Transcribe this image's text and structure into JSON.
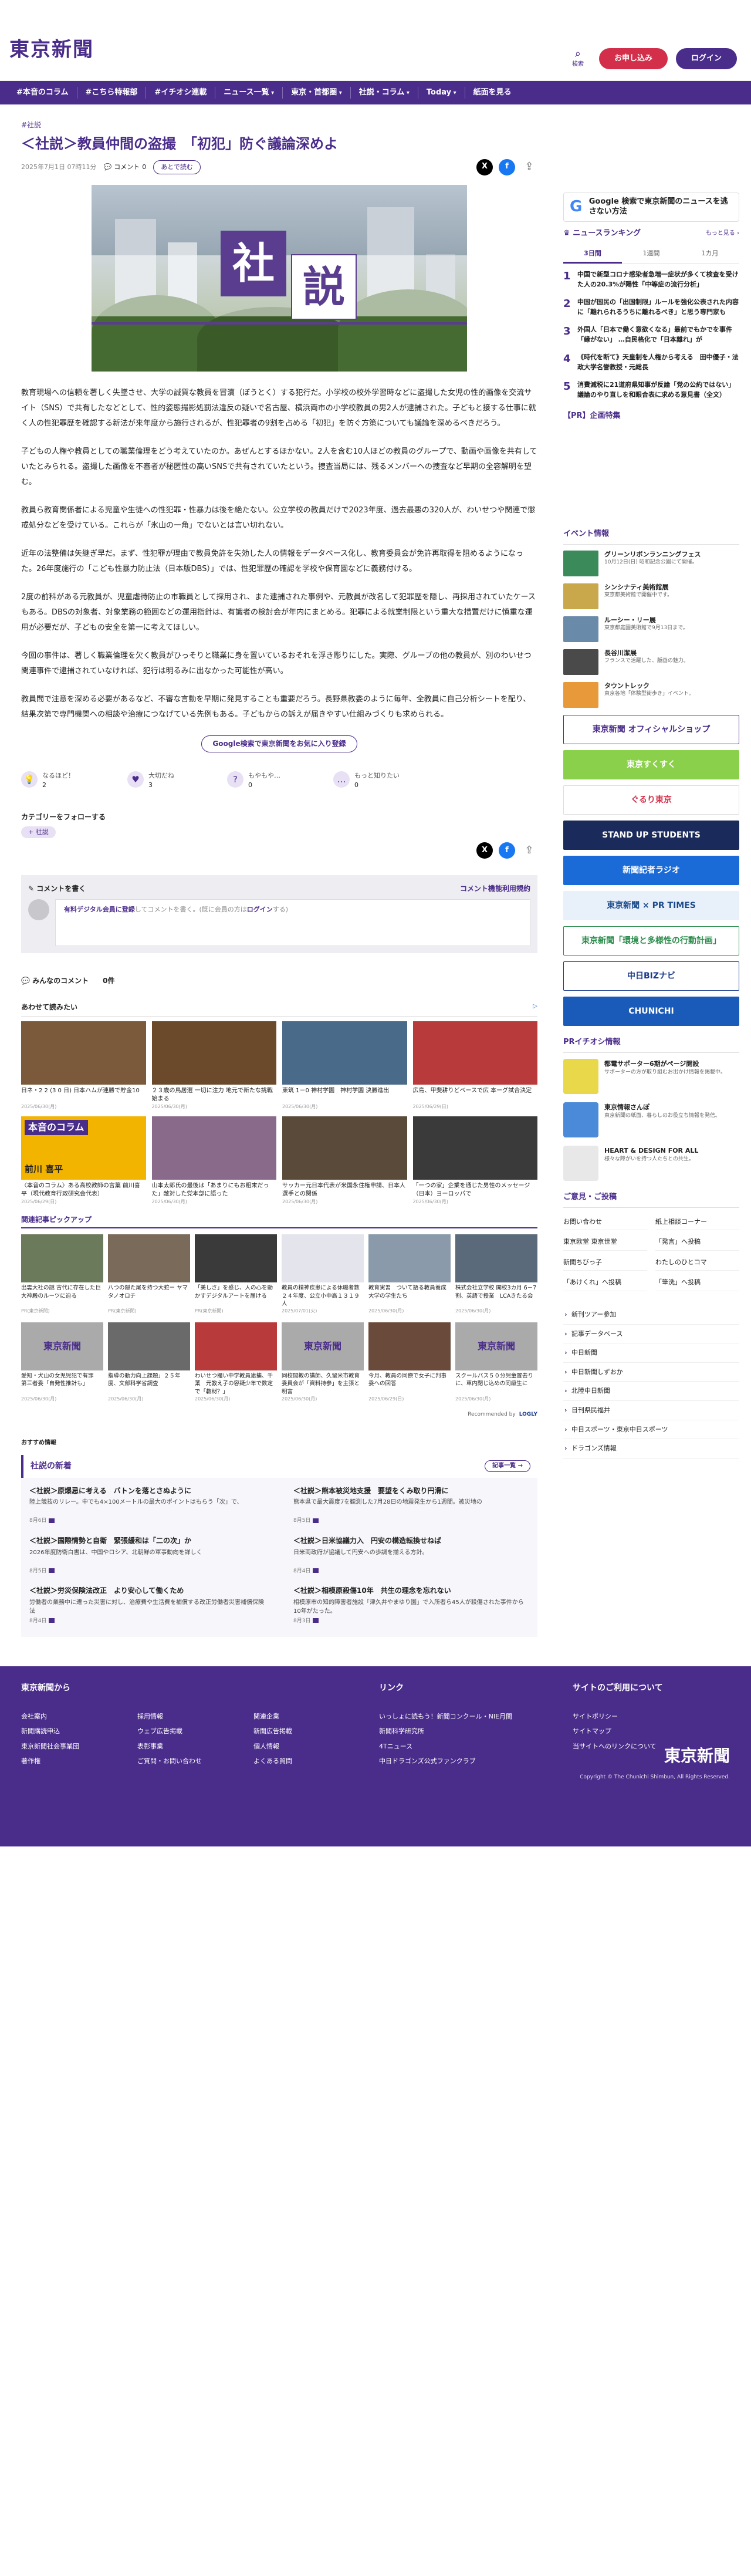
{
  "header": {
    "logo": "東京新聞",
    "search_label": "検索",
    "signup": "お申し込み",
    "login": "ログイン"
  },
  "nav": [
    "#本音のコラム",
    "#こちら特報部",
    "#イチオシ連載",
    "ニュース一覧",
    "東京・首都圏",
    "社説・コラム",
    "Today",
    "紙面を見る"
  ],
  "article": {
    "category": "#社説",
    "title": "＜社説＞教員仲間の盗撮　「初犯」防ぐ議論深めよ",
    "date": "2025年7月1日 07時11分",
    "comment_label": "コメント",
    "comment_count": "0",
    "read_later": "あとで読む",
    "hero_chars": [
      "社",
      "説"
    ],
    "paragraphs": [
      "教育現場への信頼を著しく失墜させ、大学の誠質な教員を冒瀆（ぼうとく）する犯行だ。小学校の校外学習時などに盗撮した女児の性的画像を交流サイト（SNS）で共有したなどとして、性的姿態撮影処罰法違反の疑いで名古屋、横浜両市の小学校教員の男2人が逮捕された。子どもと接する仕事に就く人の性犯罪歴を確認する新法が来年度から施行されるが、性犯罪者の9割を占める「初犯」を防ぐ方策についても議論を深めるべきだろう。",
      "子どもの人権や教員としての職業倫理をどう考えていたのか。あぜんとするほかない。2人を含む10人ほどの教員のグループで、動画や画像を共有していたとみられる。盗撮した画像を不審者が秘匿性の高いSNSで共有されていたという。捜査当局には、残るメンバーへの捜査など早期の全容解明を望む。",
      "教員ら教育関係者による児童や生徒への性犯罪・性暴力は後を絶たない。公立学校の教員だけで2023年度、過去最悪の320人が、わいせつや関連で懲戒処分などを受けている。これらが「氷山の一角」でないとは言い切れない。",
      "近年の法整備は矢継ぎ早だ。まず、性犯罪が理由で教員免許を失効した人の情報をデータベース化し、教育委員会が免許再取得を阻めるようになった。26年度施行の「こども性暴力防止法（日本版DBS）」では、性犯罪歴の確認を学校や保育園などに義務付ける。",
      "2度の前科がある元教員が、児童虐待防止の市職員として採用され、また逮捕された事例や、元教員が改名して犯罪歴を隠し、再採用されていたケースもある。DBSの対象者、対象業務の範囲などの運用指針は、有識者の検討会が年内にまとめる。犯罪による就業制限という重大な措置だけに慎重な運用が必要だが、子どもの安全を第一に考えてほしい。",
      "今回の事件は、著しく職業倫理を欠く教員がひっそりと職業に身を置いているおそれを浮き彫りにした。実際、グループの他の教員が、別のわいせつ関連事件で逮捕されていなければ、犯行は明るみに出なかった可能性が高い。",
      "教員間で注意を深める必要があるなど、不審な言動を早期に発見することも重要だろう。長野県教委のように毎年、全教員に自己分析シートを配り、結果次第で専門機関への相談や治療につなげている先例もある。子どもからの訴えが届きやすい仕組みづくりも求められる。"
    ],
    "google_follow": "Google検索で東京新聞をお気に入り登録",
    "reactions": [
      {
        "label": "なるほど！",
        "count": "2",
        "icon": "💡"
      },
      {
        "label": "大切だね",
        "count": "3",
        "icon": "♥"
      },
      {
        "label": "もやもや…",
        "count": "0",
        "icon": "?"
      },
      {
        "label": "もっと知りたい",
        "count": "0",
        "icon": "…"
      }
    ],
    "follow_heading": "カテゴリーをフォローする",
    "follow_tag": "+ 社説"
  },
  "comments": {
    "write": "コメントを書く",
    "rules": "コメント機能利用規約",
    "prompt_pre": "有料デジタル会員に登録",
    "prompt_mid": "してコメントを書く。(既に会員の方は",
    "prompt_link": "ログイン",
    "prompt_post": "する)",
    "everyone": "みんなのコメント",
    "count": "0件"
  },
  "also_read": {
    "heading": "あわせて読みたい",
    "ad": "▷",
    "cards": [
      {
        "title": "日ネ・2 2 (3 0 日) 日本ハムが連勝で貯金10",
        "source": "2025/06/30(月)",
        "color": "#7a5a3a"
      },
      {
        "title": "２３歳の鳥居選 一切に注力 地元で新たな挑戦始まる",
        "source": "2025/06/30(月)",
        "color": "#6a4a2a"
      },
      {
        "title": "東筑 1－0 神村学園　神村学園 決勝進出",
        "source": "2025/06/30(月)",
        "color": "#4a6a8a"
      },
      {
        "title": "広島、甲斐耕りどベースで広 本ーグ試合決定",
        "source": "2025/06/29(日)",
        "color": "#b83a3a"
      },
      {
        "title": "〈本音のコラム〉ある高校教師の言葉 前川喜平（現代教育行政研究会代表）",
        "source": "2025/06/29(日)",
        "color": "#f3b400"
      },
      {
        "title": "山本太郎氏の最後は「あまりにもお粗末だった」敵対した党本部に語った",
        "source": "2025/06/30(月)",
        "color": "#8a6a8a"
      },
      {
        "title": "サッカー元日本代表が米国永住権申請、日本人選手との関係",
        "source": "2025/06/30(月)",
        "color": "#5a4a3a"
      },
      {
        "title": "「一つの家」企業を通じた男性のメッセージ（日本）ヨーロッパで",
        "source": "2025/06/30(月)",
        "color": "#3a3a3a"
      }
    ],
    "column_label": "本音のコラム",
    "column_name": "前川 喜平"
  },
  "pickup": {
    "heading": "関連記事ピックアップ",
    "row1": [
      {
        "title": "出雲大社の謎 古代に存在した巨大神殿のルーツに迫る",
        "source": "PR(東京新聞)",
        "color": "#6a7a5a"
      },
      {
        "title": "八つの隠た尾を持つ大蛇ー ヤマタノオロチ",
        "source": "PR(東京新聞)",
        "color": "#7a6a5a"
      },
      {
        "title": "「美しさ」を感じ、人の心を動かすデジタルアートを届ける",
        "source": "PR(東京新聞)",
        "color": "#3a3a3a"
      },
      {
        "title": "教員の精神疾患による休職者数　２４年度、公立小中高１３１９人",
        "source": "2025/07/01(火)",
        "color": "#e4e4ec"
      },
      {
        "title": "教育実習　ついて語る教員養成大学の学生たち",
        "source": "2025/06/30(月)",
        "color": "#8a9aaa"
      },
      {
        "title": "株式会社立学校 開校3カ月 6－7割、英語で授業　LCAきたる会",
        "source": "2025/06/30(月)",
        "color": "#5a6a7a"
      }
    ],
    "row2": [
      {
        "title": "愛知・犬山の女児児犯で有罪　第三者委「自発性推計も」",
        "source": "2025/06/30(月)",
        "logo": true
      },
      {
        "title": "指導の動力向上課題」２５年度、文部科学省調査",
        "source": "2025/06/30(月)",
        "color": "#6a6a6a"
      },
      {
        "title": "わいせつ撮い中学教員逮捕、千葉　元教え子の容疑少年で数定で「教材？」",
        "source": "2025/06/30(月)",
        "color": "#b83a3a"
      },
      {
        "title": "同校間教の講師、久留米市教育委員会が「資料持参」を主張と明言",
        "source": "2025/06/30(月)",
        "logo": true
      },
      {
        "title": "今月、教員の同僚で女子に判事委への回答",
        "source": "2025/06/29(日)",
        "color": "#6a4a3a"
      },
      {
        "title": "スクールバス５０分児童置去りに、車内閉じ込めの同級生に",
        "source": "2025/06/30(月)",
        "logo": true
      }
    ],
    "recommend_by": "Recommended by",
    "recommend_brand": "LOGLY"
  },
  "recommend_label": "おすすめ情報",
  "editorial": {
    "heading": "社説の新着",
    "more": "記事一覧",
    "items": [
      {
        "title": "＜社説＞原爆忌に考える　バトンを落とさぬように",
        "summary": "陸上競技のリレー。中でも4×100メートルの最大のポイントはもらう「次」で、",
        "date": "8月6日"
      },
      {
        "title": "＜社説＞熊本被災地支援　要望をくみ取り円滑に",
        "summary": "熊本県で最大震度7を観測した7月28日の地震発生から1週間。被災地の",
        "date": "8月5日"
      },
      {
        "title": "＜社説＞国際情勢と自衛　緊張緩和は「二の次」か",
        "summary": "2026年度防衛白書は、中国やロシア、北朝鮮の軍事動向を詳しく",
        "date": "8月5日"
      },
      {
        "title": "＜社説＞日米協議力入　円安の構造転換せねば",
        "summary": "日米両政府が協議して円安への歩調を揃える方針。",
        "date": "8月4日"
      },
      {
        "title": "＜社説＞労災保険法改正　より安心して働くため",
        "summary": "労働者の業務中に遭った災害に対し、治療費や生活費を補償する改正労働者災害補償保険法",
        "date": "8月4日"
      },
      {
        "title": "＜社説＞相模原殺傷10年　共生の理念を忘れない",
        "summary": "相模原市の知的障害者施設「津久井やまゆり園」で入所者ら45人が殺傷された事件から10年がたった。",
        "date": "8月3日"
      }
    ]
  },
  "sidebar": {
    "google_text": "Google 検索で東京新聞のニュースを逃さない方法",
    "ranking_heading": "ニュースランキング",
    "ranking_more": "もっと見る ›",
    "tabs": [
      "3日間",
      "1週間",
      "1カ月"
    ],
    "ranking": [
      {
        "n": "1",
        "t": "中国で新型コロナ感染者急増一症状が多くて検査を受けた人の20.3%が陽性「中等症の流行分析」"
      },
      {
        "n": "2",
        "t": "中国が国民の「出国制限」ルールを強化公表された内容に「離れられるうちに離れるべき」と思う専門家も"
      },
      {
        "n": "3",
        "t": "外国人「日本で働く意欲くなる」最前でもかでを事件「縁がない」 …自民格化で「日本離れ」が"
      },
      {
        "n": "4",
        "t": "《時代を断て》天皇制を人権から考える　田中優子・法政大学名誉教授・元総長"
      },
      {
        "n": "5",
        "t": "消費減税に21道府県知事が反論「党の公約ではない」 議論のやり直しを和眼合表に求める意見書（全文）"
      }
    ],
    "pr_heading": "【PR】企画特集",
    "events_heading": "イベント情報",
    "events": [
      {
        "t": "グリーンリボンランニングフェス",
        "d": "10月12日(日) 昭和記念公園にて開催。",
        "color": "#3a8a5a"
      },
      {
        "t": "シンシナティ美術館展",
        "d": "東京都美術館で開催中です。",
        "color": "#c8a84a"
      },
      {
        "t": "ルーシー・リー展",
        "d": "東京都庭園美術館で9月13日まで。",
        "color": "#6a8aaa"
      },
      {
        "t": "長谷川潔展",
        "d": "フランスで活躍した、版画の魅力。",
        "color": "#4a4a4a"
      },
      {
        "t": "タウントレック",
        "d": "東京各地「体験型街歩き」イベント。",
        "color": "#e89a3a"
      }
    ],
    "banners": [
      {
        "text": "東京新聞 オフィシャルショップ",
        "bg": "#fff",
        "fg": "#4a2c8a",
        "bd": "#4a2c8a"
      },
      {
        "text": "東京すくすく",
        "bg": "#8ad04a",
        "fg": "#fff",
        "bd": "#8ad04a"
      },
      {
        "text": "ぐるり東京",
        "bg": "#fff",
        "fg": "#d32f4a",
        "bd": "#ddd"
      },
      {
        "text": "STAND UP STUDENTS",
        "bg": "#1a2a5a",
        "fg": "#fff",
        "bd": "#1a2a5a"
      },
      {
        "text": "新聞記者ラジオ",
        "bg": "#1a6ad8",
        "fg": "#fff",
        "bd": "#1a6ad8"
      },
      {
        "text": "東京新聞 × PR TIMES",
        "bg": "#e8f0fa",
        "fg": "#1a4a8a",
        "bd": "#e8f0fa"
      },
      {
        "text": "東京新聞「環境と多様性の行動計画」",
        "bg": "#fff",
        "fg": "#2a8a4a",
        "bd": "#2a8a4a"
      },
      {
        "text": "中日BIZナビ",
        "bg": "#fff",
        "fg": "#1a3a8a",
        "bd": "#1a3a8a"
      },
      {
        "text": "CHUNICHI",
        "bg": "#1a5ab8",
        "fg": "#fff",
        "bd": "#1a5ab8"
      }
    ],
    "pr_events_heading": "PRイチオシ情報",
    "pr_events": [
      {
        "t": "都電サポーター6期がページ開設",
        "d": "サポーターの方が取り組むお出かけ情報を掲載中。",
        "color": "#e8d84a"
      },
      {
        "t": "東京情報さんぽ",
        "d": "東京新聞の紙面、暮らしのお役立ち情報を発信。",
        "color": "#4a8ad8"
      },
      {
        "t": "HEART & DESIGN FOR ALL",
        "d": "様々な障がいを持つ人たちとの共生。",
        "color": "#e8e8e8"
      }
    ],
    "guide_heading": "ご意見・ご投稿",
    "guide": [
      "お問い合わせ",
      "紙上相談コーナー",
      "東京欧堂 東京世堂",
      "「発言」へ投稿",
      "新聞ちびっ子",
      "わたしのひとコマ",
      "「あけくれ」へ投稿",
      "「筆洗」へ投稿"
    ],
    "links": [
      "新刊ツアー参加",
      "記事データベース",
      "中日新聞",
      "中日新聞しずおか",
      "北陸中日新聞",
      "日刊県民福井",
      "中日スポーツ・東京中日スポーツ",
      "ドラゴンズ情報"
    ]
  },
  "footer": {
    "col1_heading": "東京新聞から",
    "col1_links": [
      "会社案内",
      "採用情報",
      "関連企業",
      "新聞購読申込",
      "ウェブ広告掲載",
      "新聞広告掲載",
      "東京新聞社会事業団",
      "表彰事業",
      "個人情報",
      "著作権",
      "ご質問・お問い合わせ",
      "よくある質問"
    ],
    "col2_heading": "リンク",
    "col2_links": [
      "いっしょに読もう！新聞コンクール・NIE月間",
      "新聞科学研究所",
      "4Tニュース",
      "中日ドラゴンズ公式ファンクラブ"
    ],
    "col3_heading": "サイトのご利用について",
    "col3_links": [
      "サイトポリシー",
      "サイトマップ",
      "当サイトへのリンクについて"
    ],
    "logo": "東京新聞",
    "copyright": "Copyright © The Chunichi Shimbun, All Rights Reserved."
  }
}
